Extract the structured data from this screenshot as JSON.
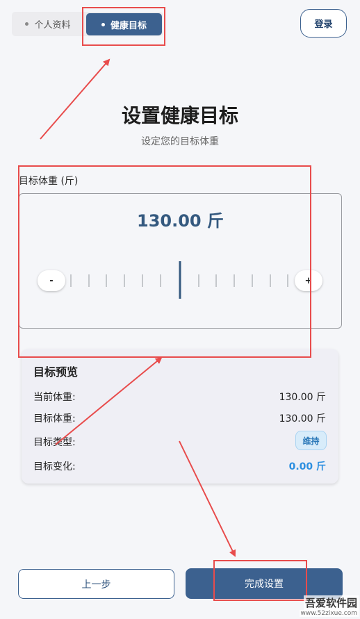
{
  "header": {
    "tabs": [
      {
        "label": "个人资料",
        "active": false
      },
      {
        "label": "健康目标",
        "active": true
      }
    ],
    "login_label": "登录"
  },
  "page": {
    "title": "设置健康目标",
    "subtitle": "设定您的目标体重"
  },
  "weight_picker": {
    "label": "目标体重 (斤)",
    "value_display": "130.00 斤",
    "minus_label": "-",
    "plus_label": "+"
  },
  "preview": {
    "title": "目标预览",
    "rows": [
      {
        "label": "当前体重:",
        "value": "130.00 斤"
      },
      {
        "label": "目标体重:",
        "value": "130.00 斤"
      },
      {
        "label": "目标类型:",
        "value": "维持"
      },
      {
        "label": "目标变化:",
        "value": "0.00 斤"
      }
    ]
  },
  "footer": {
    "back_label": "上一步",
    "finish_label": "完成设置"
  },
  "watermark": {
    "text": "吾爱软件园",
    "url": "www.52zixue.com"
  },
  "colors": {
    "primary": "#3c618f",
    "annotation_red": "#e84c4c",
    "accent_blue": "#2d8fe0"
  }
}
